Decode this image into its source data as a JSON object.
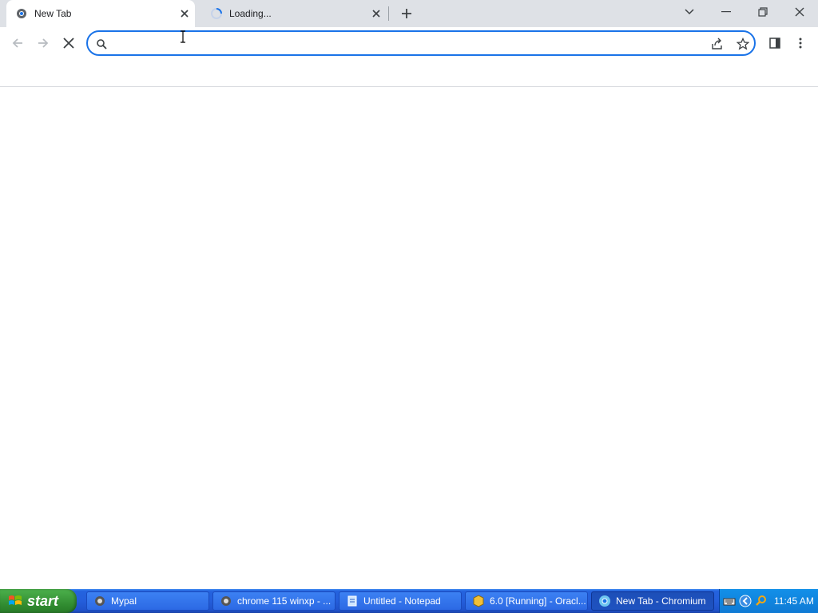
{
  "tabs": [
    {
      "title": "New Tab",
      "icon": "chromium-favicon",
      "active": true
    },
    {
      "title": "Loading...",
      "icon": "loading-spinner",
      "active": false
    }
  ],
  "toolbar": {
    "omnibox_value": "",
    "omnibox_placeholder": ""
  },
  "taskbar": {
    "start_label": "start",
    "items": [
      {
        "label": "Mypal",
        "icon": "mypal-icon"
      },
      {
        "label": "chrome 115 winxp - ...",
        "icon": "mypal-icon"
      },
      {
        "label": "Untitled - Notepad",
        "icon": "notepad-icon"
      },
      {
        "label": "6.0 [Running] - Oracl...",
        "icon": "virtualbox-icon"
      },
      {
        "label": "New Tab - Chromium",
        "icon": "chromium-icon",
        "active": true
      }
    ],
    "clock": "11:45 AM"
  },
  "colors": {
    "accent": "#1a73e8",
    "tabstrip": "#dee1e6",
    "taskbar": "#245edb",
    "start": "#3c9a3c"
  }
}
